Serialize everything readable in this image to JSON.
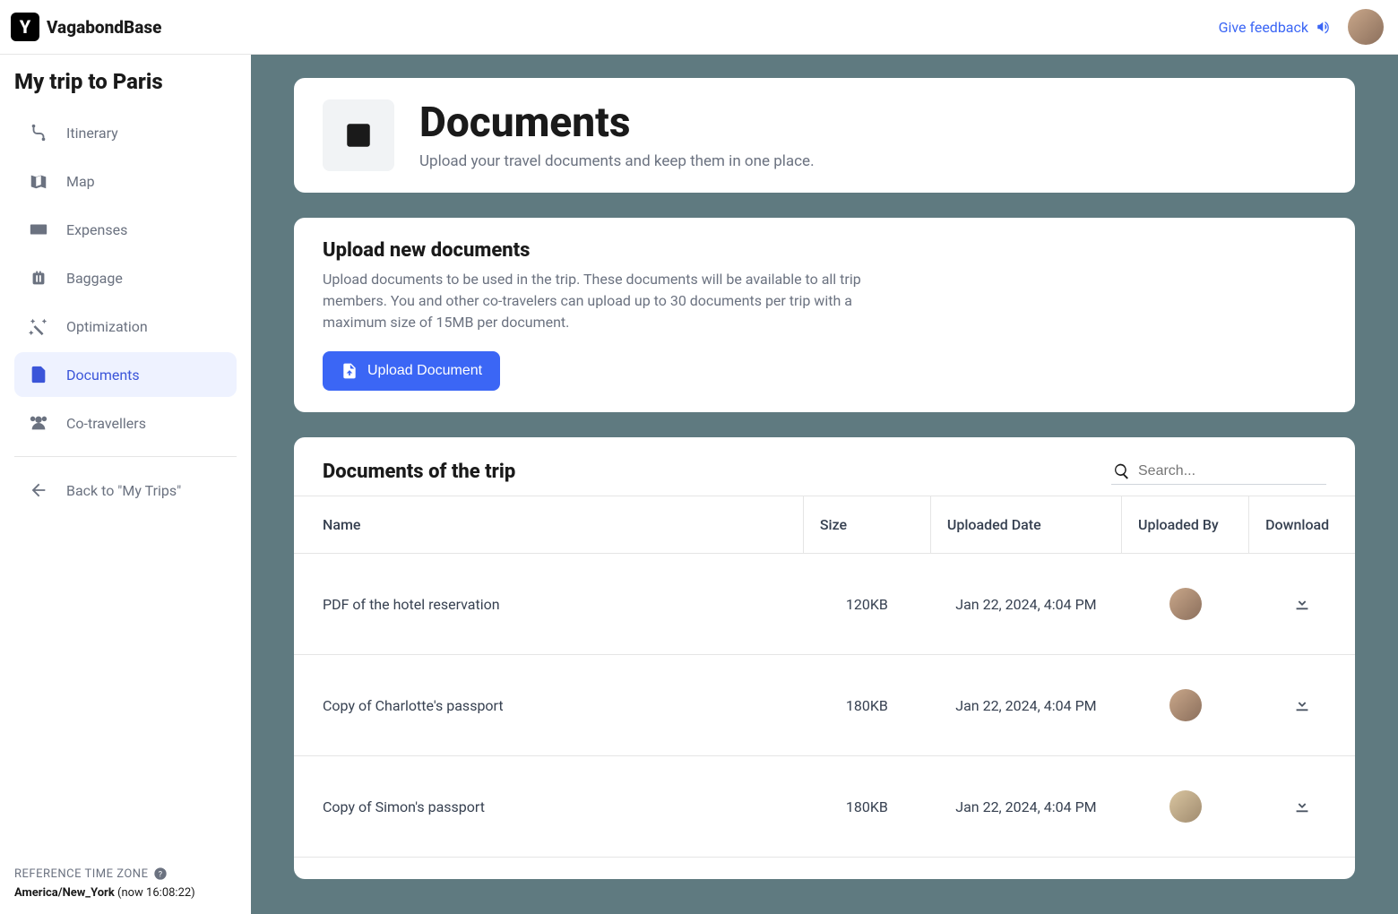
{
  "brand": {
    "name": "VagabondBase",
    "logo_letter": "Y"
  },
  "header": {
    "feedback": "Give feedback"
  },
  "sidebar": {
    "trip_title": "My trip to Paris",
    "items": [
      {
        "label": "Itinerary"
      },
      {
        "label": "Map"
      },
      {
        "label": "Expenses"
      },
      {
        "label": "Baggage"
      },
      {
        "label": "Optimization"
      },
      {
        "label": "Documents"
      },
      {
        "label": "Co-travellers"
      }
    ],
    "back_label": "Back to \"My Trips\"",
    "tz_label": "REFERENCE TIME ZONE",
    "tz_value": "America/New_York",
    "tz_now": "(now 16:08:22)"
  },
  "page": {
    "title": "Documents",
    "subtitle": "Upload your travel documents and keep them in one place."
  },
  "upload": {
    "title": "Upload new documents",
    "desc": "Upload documents to be used in the trip. These documents will be available to all trip members. You and other co-travelers can upload up to 30 documents per trip with a maximum size of 15MB per document.",
    "button": "Upload Document"
  },
  "docs": {
    "title": "Documents of the trip",
    "search_placeholder": "Search...",
    "columns": {
      "name": "Name",
      "size": "Size",
      "date": "Uploaded Date",
      "by": "Uploaded By",
      "download": "Download"
    },
    "rows": [
      {
        "name": "PDF of the hotel reservation",
        "size": "120KB",
        "date": "Jan 22, 2024, 4:04 PM",
        "avatar": "a"
      },
      {
        "name": "Copy of Charlotte's passport",
        "size": "180KB",
        "date": "Jan 22, 2024, 4:04 PM",
        "avatar": "a"
      },
      {
        "name": "Copy of Simon's passport",
        "size": "180KB",
        "date": "Jan 22, 2024, 4:04 PM",
        "avatar": "b"
      }
    ]
  }
}
